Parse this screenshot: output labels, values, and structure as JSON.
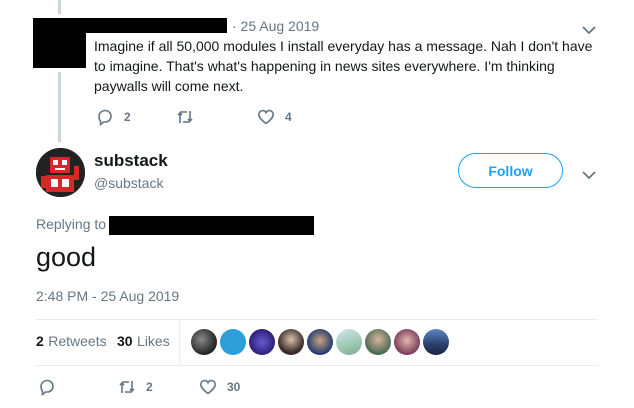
{
  "prev_tweet": {
    "date": "· 25 Aug 2019",
    "text": "Imagine if all 50,000 modules I install everyday has a message. Nah I don't have to imagine. That's what's happening in news sites everywhere. I'm thinking paywalls will come next.",
    "reply_count": "2",
    "retweet_count": "",
    "like_count": "4"
  },
  "main_tweet": {
    "name": "substack",
    "handle": "@substack",
    "follow_label": "Follow",
    "replying_to_label": "Replying to",
    "text": "good",
    "timestamp": "2:48 PM - 25 Aug 2019",
    "retweets_count": "2",
    "retweets_label": "Retweets",
    "likes_count": "30",
    "likes_label": "Likes",
    "liker_avatars": [
      "avatar-1",
      "avatar-2",
      "avatar-3",
      "avatar-4",
      "avatar-5",
      "avatar-6",
      "avatar-7",
      "avatar-8",
      "avatar-9"
    ],
    "footer_reply_count": "",
    "footer_retweet_count": "2",
    "footer_like_count": "30"
  },
  "icons": {
    "reply": "reply-icon",
    "retweet": "retweet-icon",
    "like": "heart-icon",
    "more": "chevron-down-icon"
  },
  "colors": {
    "accent": "#1da1f2",
    "muted": "#657786",
    "text": "#14171a",
    "border": "#e6ecf0"
  }
}
